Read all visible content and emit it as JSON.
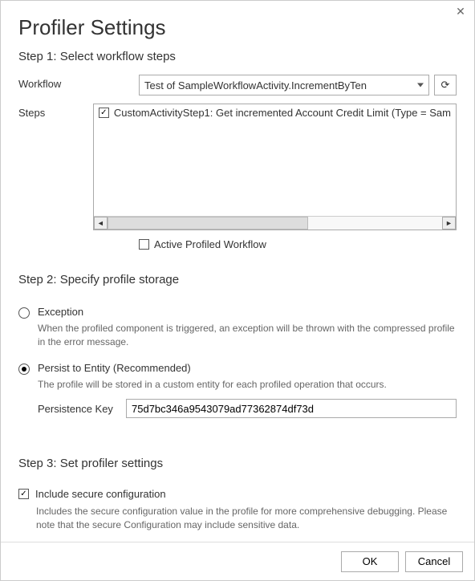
{
  "title": "Profiler Settings",
  "close_symbol": "✕",
  "step1": {
    "title": "Step 1: Select workflow steps",
    "workflow_label": "Workflow",
    "workflow_value": "Test of SampleWorkflowActivity.IncrementByTen",
    "steps_label": "Steps",
    "steps_items": [
      {
        "checked": true,
        "text": "CustomActivityStep1: Get incremented Account Credit Limit (Type = Sam"
      }
    ],
    "active_profiled_label": "Active Profiled Workflow",
    "active_profiled_checked": false
  },
  "step2": {
    "title": "Step 2: Specify profile storage",
    "options": [
      {
        "name": "exception",
        "label": "Exception",
        "desc": "When the profiled component is triggered, an exception will be thrown with the compressed profile in the error message.",
        "selected": false
      },
      {
        "name": "persist",
        "label": "Persist to Entity (Recommended)",
        "desc": "The profile will be stored in a custom entity for each profiled operation that occurs.",
        "selected": true
      }
    ],
    "persistence_key_label": "Persistence Key",
    "persistence_key_value": "75d7bc346a9543079ad77362874df73d"
  },
  "step3": {
    "title": "Step 3: Set profiler settings",
    "include_secure_label": "Include secure configuration",
    "include_secure_checked": true,
    "include_secure_desc": "Includes the secure configuration value in the profile for more comprehensive debugging. Please note that the secure Configuration may include sensitive data."
  },
  "footer": {
    "ok": "OK",
    "cancel": "Cancel"
  }
}
